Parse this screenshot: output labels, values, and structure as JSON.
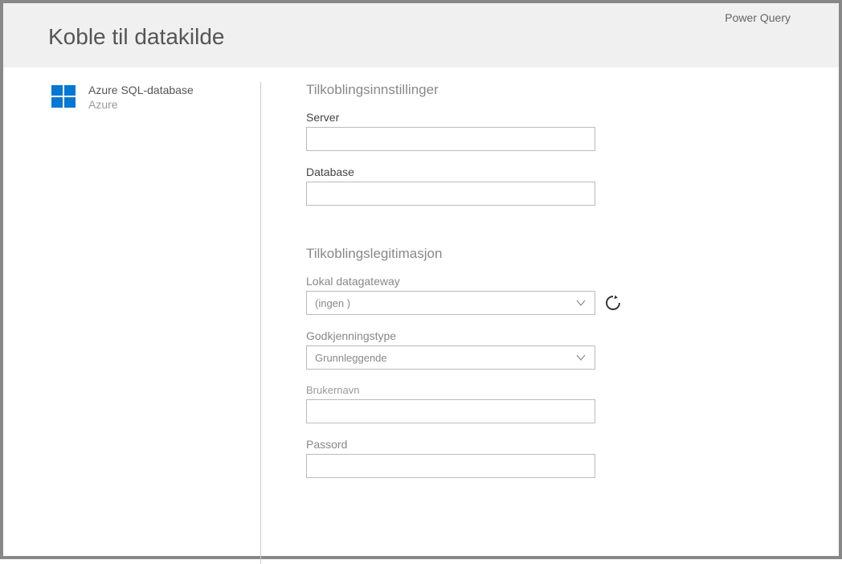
{
  "header": {
    "product_label": "Power Query",
    "page_title": "Koble til datakilde"
  },
  "sidebar": {
    "item": {
      "title": "Azure SQL-database",
      "subtitle": "Azure"
    }
  },
  "main": {
    "section1_heading": "Tilkoblingsinnstillinger",
    "server_label": "Server",
    "database_label": "Database",
    "section2_heading": "Tilkoblingslegitimasjon",
    "gateway_label": "Lokal datagateway",
    "gateway_value": "(ingen )",
    "authtype_label": "Godkjenningstype",
    "authtype_value": "Grunnleggende",
    "username_label": "Brukernavn",
    "password_label": "Passord"
  }
}
